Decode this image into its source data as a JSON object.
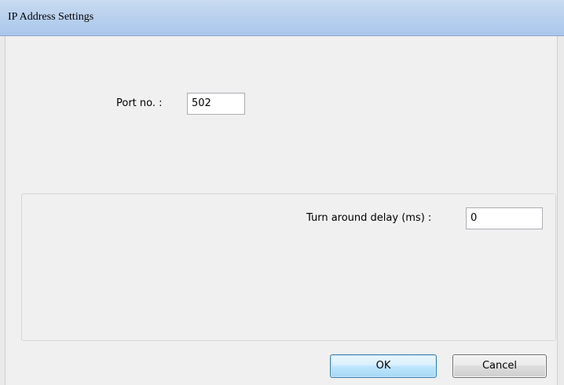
{
  "window": {
    "title": "IP Address Settings"
  },
  "port": {
    "label": "Port no. :",
    "value": "502"
  },
  "turnaround": {
    "label": "Turn around delay (ms) :",
    "value": "0"
  },
  "buttons": {
    "ok_label": "OK",
    "cancel_label": "Cancel"
  },
  "colors": {
    "titlebar": "#b7d0ef",
    "ok_button_border": "#3c7fb1",
    "background": "#f0f0f0"
  }
}
